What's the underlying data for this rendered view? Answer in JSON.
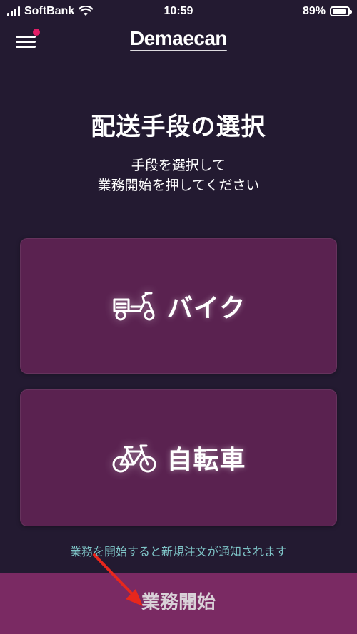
{
  "status_bar": {
    "carrier": "SoftBank",
    "time": "10:59",
    "battery_percent": "89%",
    "battery_level": 0.89,
    "signal_icon": "signal-icon",
    "wifi_icon": "wifi-icon",
    "battery_icon": "battery-icon"
  },
  "header": {
    "menu_icon": "hamburger-menu-icon",
    "notification_dot_color": "#e41d67",
    "logo_text": "Demaecan"
  },
  "main": {
    "title": "配送手段の選択",
    "instructions": [
      "手段を選択して",
      "業務開始を押してください"
    ],
    "options": [
      {
        "label": "バイク",
        "icon": "motorbike-icon"
      },
      {
        "label": "自転車",
        "icon": "bicycle-icon"
      }
    ],
    "notice": "業務を開始すると新規注文が通知されます"
  },
  "footer": {
    "start_button_label": "業務開始"
  },
  "annotation": {
    "arrow_color": "#e8271c"
  },
  "colors": {
    "background": "#231a31",
    "card": "#5a2250",
    "button": "#7a2a63",
    "notice_text": "#7fc5c8"
  }
}
